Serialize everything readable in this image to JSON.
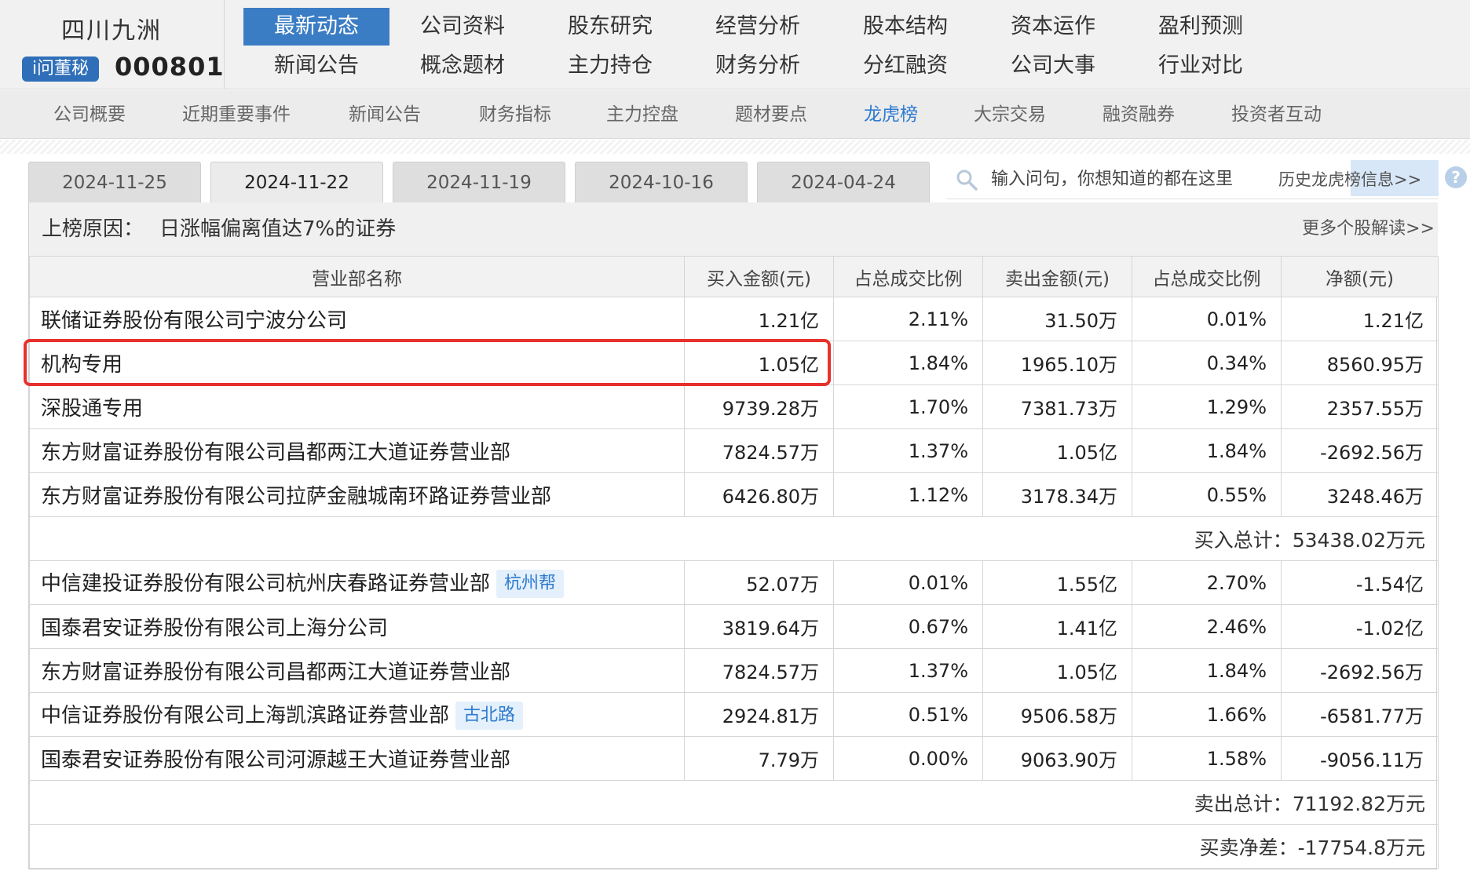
{
  "stock": {
    "name": "四川九洲",
    "badge": "i问董秘",
    "code": "000801"
  },
  "nav_main": [
    [
      "最新动态",
      "公司资料",
      "股东研究",
      "经营分析",
      "股本结构",
      "资本运作",
      "盈利预测"
    ],
    [
      "新闻公告",
      "概念题材",
      "主力持仓",
      "财务分析",
      "分红融资",
      "公司大事",
      "行业对比"
    ]
  ],
  "nav_main_active": "最新动态",
  "sub_nav": [
    "公司概要",
    "近期重要事件",
    "新闻公告",
    "财务指标",
    "主力控盘",
    "题材要点",
    "龙虎榜",
    "大宗交易",
    "融资融券",
    "投资者互动"
  ],
  "sub_nav_active": "龙虎榜",
  "date_tabs": [
    "2024-11-25",
    "2024-11-22",
    "2024-11-19",
    "2024-10-16",
    "2024-04-24"
  ],
  "date_tab_active": "2024-11-22",
  "search": {
    "placeholder": "输入问句，你想知道的都在这里",
    "history_link": "历史龙虎榜信息>>"
  },
  "reason": {
    "label": "上榜原因：",
    "text": "日涨幅偏离值达7%的证券",
    "more_link": "更多个股解读>>"
  },
  "table": {
    "headers": [
      "营业部名称",
      "买入金额(元)",
      "占总成交比例",
      "卖出金额(元)",
      "占总成交比例",
      "净额(元)"
    ],
    "buy_rows": [
      {
        "name": "联储证券股份有限公司宁波分公司",
        "tag": "",
        "buy": "1.21亿",
        "buy_pct": "2.11%",
        "sell": "31.50万",
        "sell_pct": "0.01%",
        "net": "1.21亿"
      },
      {
        "name": "机构专用",
        "tag": "",
        "buy": "1.05亿",
        "buy_pct": "1.84%",
        "sell": "1965.10万",
        "sell_pct": "0.34%",
        "net": "8560.95万"
      },
      {
        "name": "深股通专用",
        "tag": "",
        "buy": "9739.28万",
        "buy_pct": "1.70%",
        "sell": "7381.73万",
        "sell_pct": "1.29%",
        "net": "2357.55万"
      },
      {
        "name": "东方财富证券股份有限公司昌都两江大道证券营业部",
        "tag": "",
        "buy": "7824.57万",
        "buy_pct": "1.37%",
        "sell": "1.05亿",
        "sell_pct": "1.84%",
        "net": "-2692.56万"
      },
      {
        "name": "东方财富证券股份有限公司拉萨金融城南环路证券营业部",
        "tag": "",
        "buy": "6426.80万",
        "buy_pct": "1.12%",
        "sell": "3178.34万",
        "sell_pct": "0.55%",
        "net": "3248.46万"
      }
    ],
    "buy_total_label": "买入总计：",
    "buy_total_value": "53438.02万元",
    "sell_rows": [
      {
        "name": "中信建投证券股份有限公司杭州庆春路证券营业部",
        "tag": "杭州帮",
        "buy": "52.07万",
        "buy_pct": "0.01%",
        "sell": "1.55亿",
        "sell_pct": "2.70%",
        "net": "-1.54亿"
      },
      {
        "name": "国泰君安证券股份有限公司上海分公司",
        "tag": "",
        "buy": "3819.64万",
        "buy_pct": "0.67%",
        "sell": "1.41亿",
        "sell_pct": "2.46%",
        "net": "-1.02亿"
      },
      {
        "name": "东方财富证券股份有限公司昌都两江大道证券营业部",
        "tag": "",
        "buy": "7824.57万",
        "buy_pct": "1.37%",
        "sell": "1.05亿",
        "sell_pct": "1.84%",
        "net": "-2692.56万"
      },
      {
        "name": "中信证券股份有限公司上海凯滨路证券营业部",
        "tag": "古北路",
        "buy": "2924.81万",
        "buy_pct": "0.51%",
        "sell": "9506.58万",
        "sell_pct": "1.66%",
        "net": "-6581.77万"
      },
      {
        "name": "国泰君安证券股份有限公司河源越王大道证券营业部",
        "tag": "",
        "buy": "7.79万",
        "buy_pct": "0.00%",
        "sell": "9063.90万",
        "sell_pct": "1.58%",
        "net": "-9056.11万"
      }
    ],
    "sell_total_label": "卖出总计：",
    "sell_total_value": "71192.82万元",
    "net_diff_label": "买卖净差：",
    "net_diff_value": "-17754.8万元"
  },
  "highlight_color": "#e8302c",
  "accent_color": "#3b7dc4"
}
